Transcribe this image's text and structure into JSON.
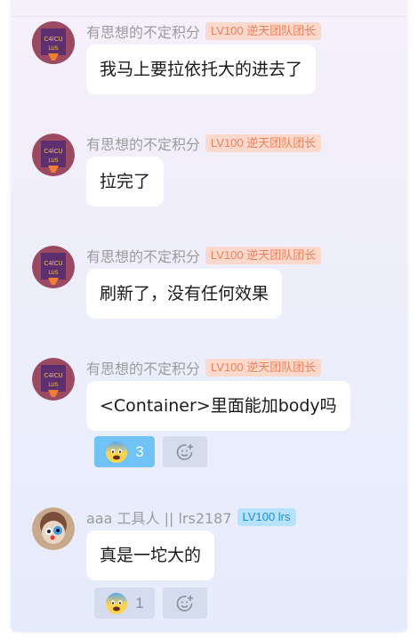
{
  "messages": [
    {
      "name": "有思想的不定积分",
      "badge": "LV100 逆天团队团长",
      "badge_style": "orange",
      "text": "我马上要拉依托大的进去了"
    },
    {
      "name": "有思想的不定积分",
      "badge": "LV100 逆天团队团长",
      "badge_style": "orange",
      "text": "拉完了"
    },
    {
      "name": "有思想的不定积分",
      "badge": "LV100 逆天团队团长",
      "badge_style": "orange",
      "text": "刷新了，没有任何效果"
    },
    {
      "name": "有思想的不定积分",
      "badge": "LV100 逆天团队团长",
      "badge_style": "orange",
      "text": "<Container>里面能加body吗",
      "reaction": {
        "emoji": "anxious-face-with-sweat",
        "count": "3",
        "active": true
      }
    },
    {
      "name": "aaa 工具人 || lrs2187",
      "badge": "LV100 lrs",
      "badge_style": "blue",
      "text": "真是一坨大的",
      "reaction": {
        "emoji": "anxious-face-with-sweat",
        "count": "1",
        "active": false
      }
    }
  ],
  "icons": {
    "add_reaction": "smiley-plus-icon"
  },
  "colors": {
    "badge_orange_bg": "#fbd9cc",
    "badge_orange_text": "#f0805a",
    "badge_blue_bg": "#b7e2fb",
    "badge_blue_text": "#1f8fd8",
    "reaction_active": "#6fc3f7"
  }
}
